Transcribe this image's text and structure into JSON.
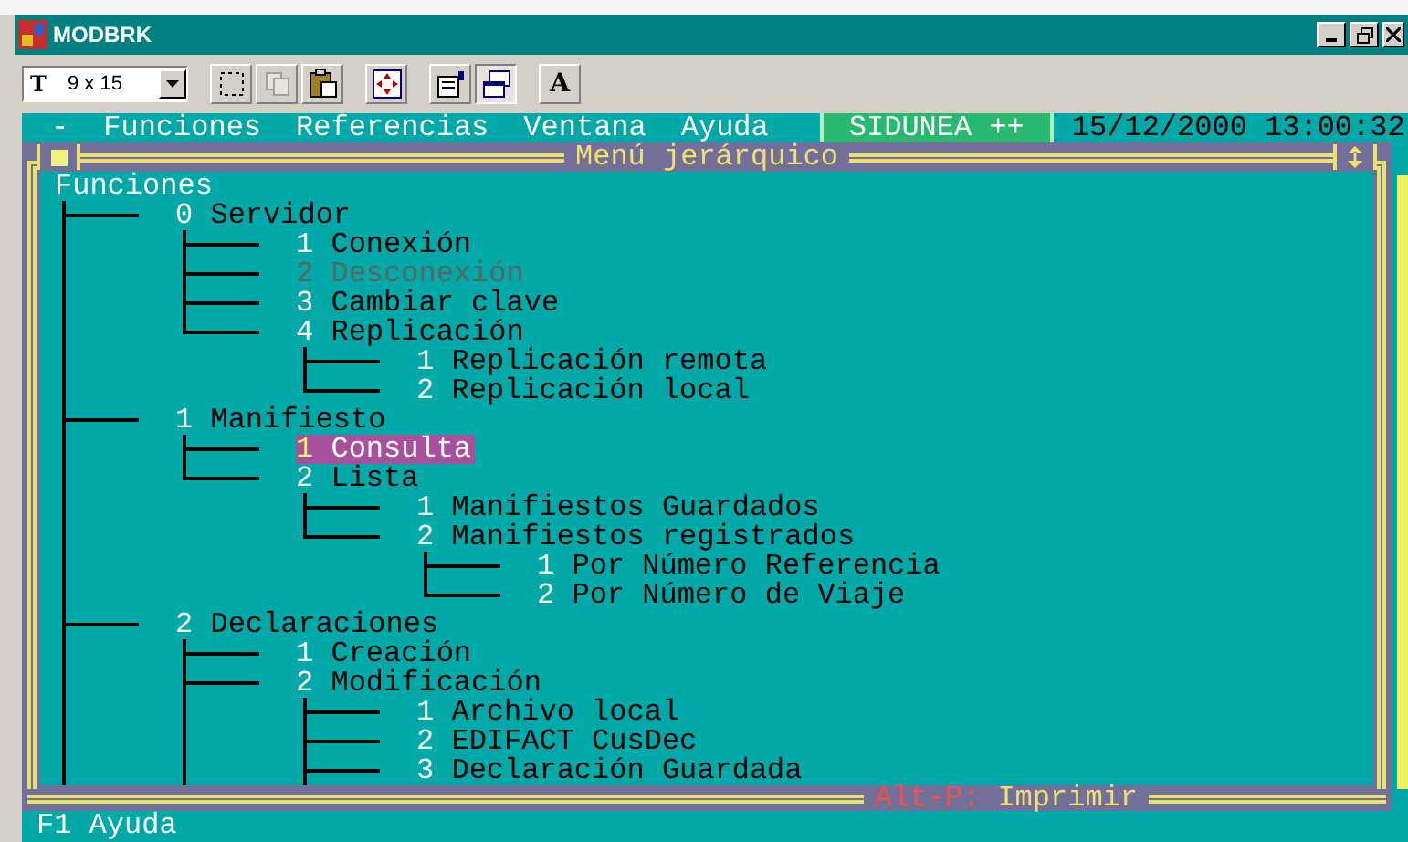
{
  "window": {
    "title": "MODBRK"
  },
  "toolbar": {
    "font_glyph": "T",
    "font_size": "9 x 15",
    "font_button": "A"
  },
  "menu_bar": {
    "items": [
      {
        "label": "-"
      },
      {
        "label": "Funciones"
      },
      {
        "label": "Referencias"
      },
      {
        "label": "Ventana"
      },
      {
        "label": "Ayuda"
      }
    ],
    "product": "SIDUNEA ++",
    "datetime": "15/12/2000 13:00:32"
  },
  "panel": {
    "title": "Menú jerárquico",
    "tree": {
      "label": "Funciones",
      "more_below": true,
      "children": [
        {
          "number": "0",
          "label": "Servidor",
          "selected": false,
          "disabled": false,
          "more_below": false,
          "children": [
            {
              "number": "1",
              "label": "Conexión",
              "selected": false,
              "disabled": false
            },
            {
              "number": "2",
              "label": "Desconexión",
              "selected": false,
              "disabled": true
            },
            {
              "number": "3",
              "label": "Cambiar clave",
              "selected": false,
              "disabled": false
            },
            {
              "number": "4",
              "label": "Replicación",
              "selected": false,
              "disabled": false,
              "more_below": false,
              "children": [
                {
                  "number": "1",
                  "label": "Replicación remota",
                  "selected": false,
                  "disabled": false
                },
                {
                  "number": "2",
                  "label": "Replicación local",
                  "selected": false,
                  "disabled": false
                }
              ]
            }
          ]
        },
        {
          "number": "1",
          "label": "Manifiesto",
          "selected": false,
          "disabled": false,
          "more_below": false,
          "children": [
            {
              "number": "1",
              "label": "Consulta",
              "selected": true,
              "disabled": false
            },
            {
              "number": "2",
              "label": "Lista",
              "selected": false,
              "disabled": false,
              "more_below": false,
              "children": [
                {
                  "number": "1",
                  "label": "Manifiestos Guardados",
                  "selected": false,
                  "disabled": false
                },
                {
                  "number": "2",
                  "label": "Manifiestos registrados",
                  "selected": false,
                  "disabled": false,
                  "more_below": false,
                  "children": [
                    {
                      "number": "1",
                      "label": "Por Número Referencia",
                      "selected": false,
                      "disabled": false
                    },
                    {
                      "number": "2",
                      "label": "Por Número de Viaje",
                      "selected": false,
                      "disabled": false
                    }
                  ]
                }
              ]
            }
          ]
        },
        {
          "number": "2",
          "label": "Declaraciones",
          "selected": false,
          "disabled": false,
          "more_below": true,
          "children": [
            {
              "number": "1",
              "label": "Creación",
              "selected": false,
              "disabled": false
            },
            {
              "number": "2",
              "label": "Modificación",
              "selected": false,
              "disabled": false,
              "more_below": true,
              "children": [
                {
                  "number": "1",
                  "label": "Archivo local",
                  "selected": false,
                  "disabled": false
                },
                {
                  "number": "2",
                  "label": "EDIFACT CusDec",
                  "selected": false,
                  "disabled": false
                },
                {
                  "number": "3",
                  "label": "Declaración Guardada",
                  "selected": false,
                  "disabled": false
                }
              ]
            }
          ]
        }
      ]
    },
    "footer": {
      "hotkey": "Alt-P:",
      "label": "Imprimir"
    }
  },
  "status_bar": {
    "text": "F1 Ayuda"
  }
}
